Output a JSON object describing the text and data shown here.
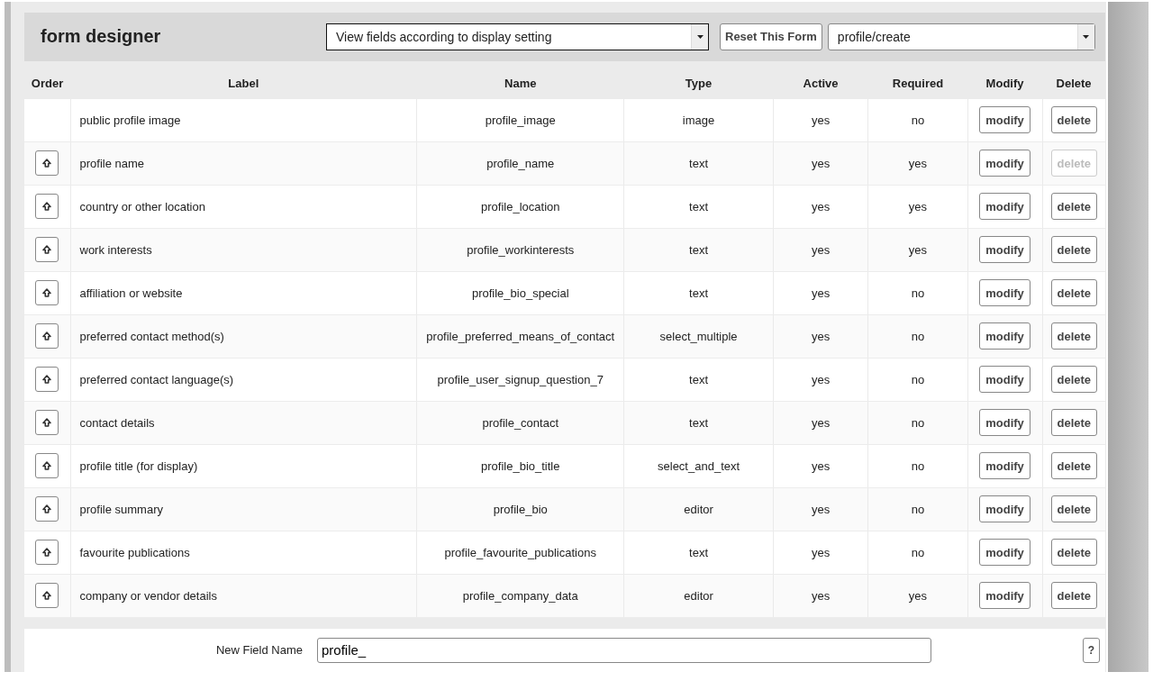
{
  "header": {
    "title": "form designer",
    "view_select": {
      "value": "View fields according to display setting"
    },
    "reset_button": "Reset This Form",
    "form_select": {
      "value": "profile/create"
    }
  },
  "table": {
    "columns": [
      "Order",
      "Label",
      "Name",
      "Type",
      "Active",
      "Required",
      "Modify",
      "Delete"
    ],
    "rows": [
      {
        "movable": false,
        "label": "public profile image",
        "name": "profile_image",
        "type": "image",
        "active": "yes",
        "required": "no",
        "modify": "modify",
        "delete": "delete",
        "delete_disabled": false
      },
      {
        "movable": true,
        "label": "profile name",
        "name": "profile_name",
        "type": "text",
        "active": "yes",
        "required": "yes",
        "modify": "modify",
        "delete": "delete",
        "delete_disabled": true
      },
      {
        "movable": true,
        "label": "country or other location",
        "name": "profile_location",
        "type": "text",
        "active": "yes",
        "required": "yes",
        "modify": "modify",
        "delete": "delete",
        "delete_disabled": false
      },
      {
        "movable": true,
        "label": "work interests",
        "name": "profile_workinterests",
        "type": "text",
        "active": "yes",
        "required": "yes",
        "modify": "modify",
        "delete": "delete",
        "delete_disabled": false
      },
      {
        "movable": true,
        "label": "affiliation or website",
        "name": "profile_bio_special",
        "type": "text",
        "active": "yes",
        "required": "no",
        "modify": "modify",
        "delete": "delete",
        "delete_disabled": false
      },
      {
        "movable": true,
        "label": "preferred contact method(s)",
        "name": "profile_preferred_means_of_contact",
        "type": "select_multiple",
        "active": "yes",
        "required": "no",
        "modify": "modify",
        "delete": "delete",
        "delete_disabled": false
      },
      {
        "movable": true,
        "label": "preferred contact language(s)",
        "name": "profile_user_signup_question_7",
        "type": "text",
        "active": "yes",
        "required": "no",
        "modify": "modify",
        "delete": "delete",
        "delete_disabled": false
      },
      {
        "movable": true,
        "label": "contact details",
        "name": "profile_contact",
        "type": "text",
        "active": "yes",
        "required": "no",
        "modify": "modify",
        "delete": "delete",
        "delete_disabled": false
      },
      {
        "movable": true,
        "label": "profile title (for display)",
        "name": "profile_bio_title",
        "type": "select_and_text",
        "active": "yes",
        "required": "no",
        "modify": "modify",
        "delete": "delete",
        "delete_disabled": false
      },
      {
        "movable": true,
        "label": "profile summary",
        "name": "profile_bio",
        "type": "editor",
        "active": "yes",
        "required": "no",
        "modify": "modify",
        "delete": "delete",
        "delete_disabled": false
      },
      {
        "movable": true,
        "label": "favourite publications",
        "name": "profile_favourite_publications",
        "type": "text",
        "active": "yes",
        "required": "no",
        "modify": "modify",
        "delete": "delete",
        "delete_disabled": false
      },
      {
        "movable": true,
        "label": "company or vendor details",
        "name": "profile_company_data",
        "type": "editor",
        "active": "yes",
        "required": "yes",
        "modify": "modify",
        "delete": "delete",
        "delete_disabled": false
      }
    ]
  },
  "new_field": {
    "label": "New Field Name",
    "value": "profile_",
    "help_button": "?"
  }
}
